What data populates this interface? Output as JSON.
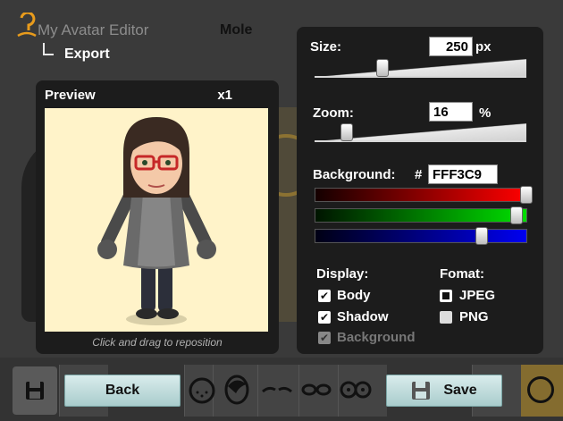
{
  "app": {
    "title": "My Avatar Editor",
    "subtitle": "Mole"
  },
  "nav": {
    "current": "Export"
  },
  "preview": {
    "title": "Preview",
    "scale": "x1",
    "background_color": "#fff3c9",
    "hint": "Click and drag to reposition"
  },
  "settings": {
    "size": {
      "label": "Size:",
      "value": "250",
      "unit": "px",
      "slider_fraction": 0.32
    },
    "zoom": {
      "label": "Zoom:",
      "value": "16",
      "unit": "%",
      "slider_fraction": 0.15
    },
    "background": {
      "label": "Background:",
      "hash": "#",
      "hex": "FFF3C9",
      "red": 255,
      "green": 243,
      "blue": 201
    },
    "display": {
      "heading": "Display:",
      "options": [
        {
          "label": "Body",
          "checked": true,
          "enabled": true
        },
        {
          "label": "Shadow",
          "checked": true,
          "enabled": true
        },
        {
          "label": "Background",
          "checked": true,
          "enabled": false
        }
      ]
    },
    "format": {
      "heading": "Fomat:",
      "options": [
        {
          "label": "JPEG",
          "selected": true
        },
        {
          "label": "PNG",
          "selected": false
        }
      ]
    }
  },
  "toolbar": {
    "back_label": "Back",
    "save_label": "Save",
    "icons": [
      "floppy-disk-icon",
      "face-icon",
      "hair-icon",
      "eyebrows-icon",
      "eyes-icon",
      "glasses-icon",
      "head-ring-icon"
    ]
  },
  "colors": {
    "accent": "#a9cccc",
    "panel": "#1c1c1c",
    "red_slider": "#d40000",
    "green_slider": "#00c000",
    "blue_slider": "#0000e0"
  }
}
